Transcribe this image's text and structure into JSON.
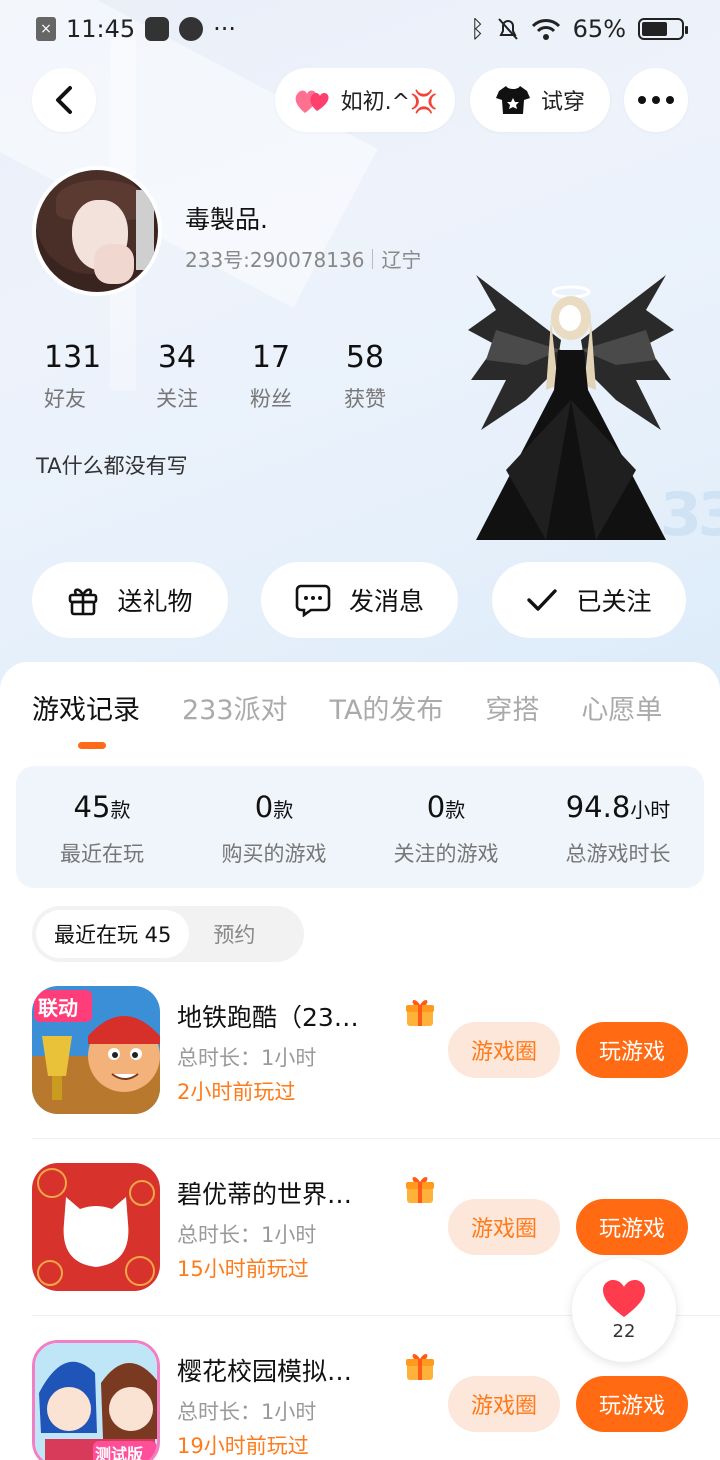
{
  "status_bar": {
    "time": "11:45",
    "battery": "65%",
    "battery_level": 0.65
  },
  "header": {
    "tag_label": "如初.^💢",
    "try_on_label": "试穿"
  },
  "profile": {
    "nickname": "毒製品.",
    "uid_text": "233号:290078136",
    "region": "辽宁",
    "bio": "TA什么都没有写",
    "stats": [
      {
        "value": "131",
        "label": "好友"
      },
      {
        "value": "34",
        "label": "关注"
      },
      {
        "value": "17",
        "label": "粉丝"
      },
      {
        "value": "58",
        "label": "获赞"
      }
    ],
    "watermark": "33"
  },
  "actions": {
    "gift": "送礼物",
    "message": "发消息",
    "follow": "已关注"
  },
  "tabs": [
    "游戏记录",
    "233派对",
    "TA的发布",
    "穿搭",
    "心愿单"
  ],
  "summary": [
    {
      "value": "45",
      "unit": "款",
      "label": "最近在玩"
    },
    {
      "value": "0",
      "unit": "款",
      "label": "购买的游戏"
    },
    {
      "value": "0",
      "unit": "款",
      "label": "关注的游戏"
    },
    {
      "value": "94.8",
      "unit": "小时",
      "label": "总游戏时长"
    }
  ],
  "segment": {
    "recent": "最近在玩 45",
    "reserve": "预约"
  },
  "games": [
    {
      "title": "地铁跑酷（23…",
      "duration": "总时长：1小时",
      "ago": "2小时前玩过",
      "icon_badge": "联动",
      "circle_btn": "游戏圈",
      "play_btn": "玩游戏"
    },
    {
      "title": "碧优蒂的世界…",
      "duration": "总时长：1小时",
      "ago": "15小时前玩过",
      "icon_badge": "",
      "circle_btn": "游戏圈",
      "play_btn": "玩游戏"
    },
    {
      "title": "樱花校园模拟…",
      "duration": "总时长：1小时",
      "ago": "19小时前玩过",
      "icon_badge": "测试版",
      "circle_btn": "游戏圈",
      "play_btn": "玩游戏"
    }
  ],
  "like_fab": {
    "count": "22"
  },
  "colors": {
    "accent": "#ff6a12",
    "accent_light": "#fde7da",
    "recent_text": "#ff7a1a"
  }
}
